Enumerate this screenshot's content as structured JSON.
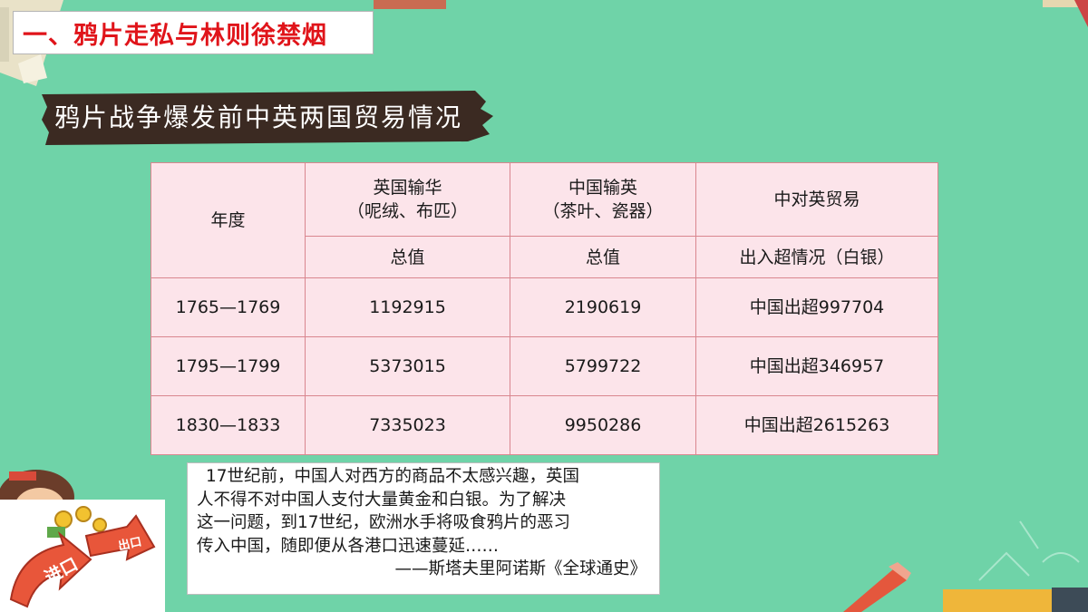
{
  "section_title": "一、鸦片走私与林则徐禁烟",
  "banner_title": "鸦片战争爆发前中英两国贸易情况",
  "table": {
    "header": {
      "year": "年度",
      "uk_export": "英国输华",
      "uk_export_note": "（呢绒、布匹）",
      "cn_export": "中国输英",
      "cn_export_note": "（茶叶、瓷器）",
      "trade": "中对英贸易",
      "total_uk": "总值",
      "total_cn": "总值",
      "balance": "出入超情况（白银）"
    },
    "rows": [
      {
        "year": "1765—1769",
        "uk": "1192915",
        "cn": "2190619",
        "balance": "中国出超997704"
      },
      {
        "year": "1795—1799",
        "uk": "5373015",
        "cn": "5799722",
        "balance": "中国出超346957"
      },
      {
        "year": "1830—1833",
        "uk": "7335023",
        "cn": "9950286",
        "balance": "中国出超2615263"
      }
    ]
  },
  "quote": {
    "lines": [
      "17世纪前，中国人对西方的商品不太感兴趣，英国",
      "人不得不对中国人支付大量黄金和白银。为了解决",
      "这一问题，到17世纪，欧洲水手将吸食鸦片的恶习",
      "传入中国，随即便从各港口迅速蔓延……"
    ],
    "source": "——斯塔夫里阿诺斯《全球通史》"
  },
  "sticker": {
    "label_in": "进口",
    "label_out": "出口"
  },
  "colors": {
    "background": "#6fd3a8",
    "title_red": "#e0141a",
    "banner_brown": "#3b2a22",
    "table_pink": "#fce4ea",
    "table_border": "#d9868f"
  }
}
